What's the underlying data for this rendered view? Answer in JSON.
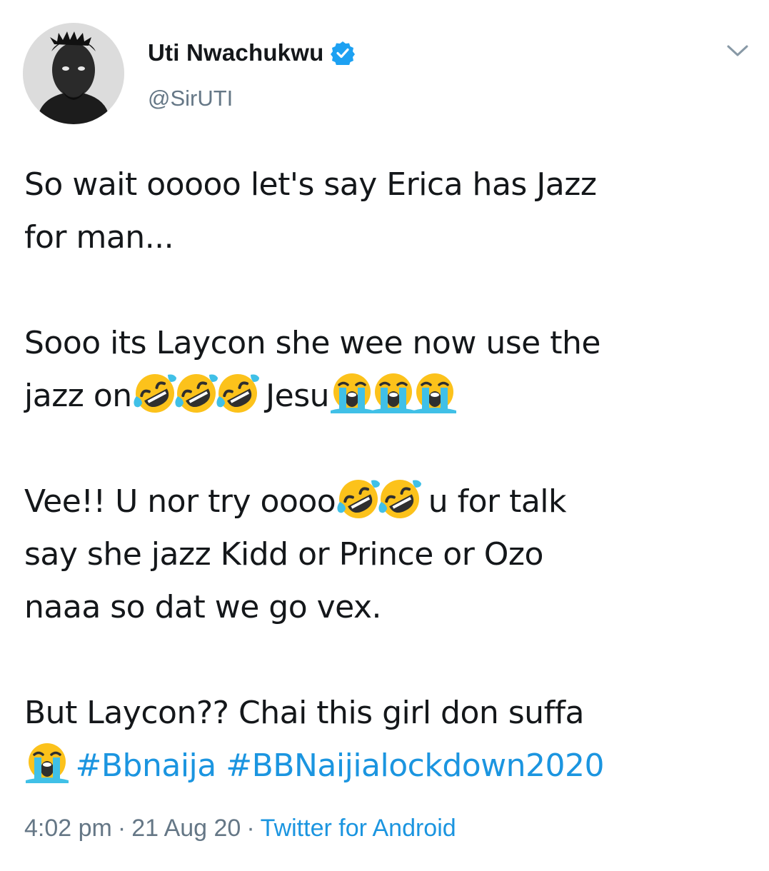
{
  "user": {
    "display_name": "Uti Nwachukwu",
    "handle": "@SirUTI",
    "verified": true
  },
  "tweet": {
    "p1_l1": "So wait ooooo let's say Erica has Jazz",
    "p1_l2": "for man...",
    "p2_l1": "Sooo its Laycon she wee now use the",
    "p2_l2_a": "jazz on",
    "p2_l2_b": " Jesu",
    "p3_l1_a": "Vee!! U nor try oooo",
    "p3_l1_b": " u for talk",
    "p3_l2": "say she jazz Kidd or Prince or Ozo",
    "p3_l3": "naaa so dat we go vex.",
    "p4_l1": "But Laycon?? Chai this girl don suffa",
    "hashtag_1": "#Bbnaija",
    "hashtag_2": "#BBNaijialockdown2020"
  },
  "meta": {
    "time": "4:02 pm",
    "separator": "·",
    "date": "21 Aug 20",
    "source": "Twitter for Android"
  },
  "icons": {
    "verified": "verified-badge-icon",
    "menu": "chevron-down-icon",
    "rofl": "rolling-on-floor-laughing-emoji",
    "crying": "loudly-crying-face-emoji"
  },
  "colors": {
    "text": "#14171a",
    "secondary": "#657786",
    "link": "#1b95e0",
    "verified": "#1da1f2"
  }
}
